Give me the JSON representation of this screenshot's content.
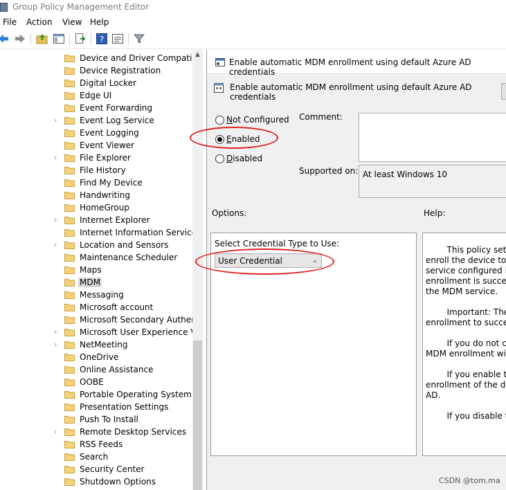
{
  "window": {
    "title": "Group Policy Management Editor"
  },
  "menu": {
    "items": [
      "File",
      "Action",
      "View",
      "Help"
    ]
  },
  "toolbar": {
    "buttons": [
      "back-icon",
      "forward-icon",
      "up-folder-icon",
      "show-hide-tree-icon",
      "export-list-icon",
      "help-icon",
      "properties-icon",
      "filter-icon"
    ]
  },
  "tree": {
    "items": [
      {
        "label": "Device and Driver Compatibilit",
        "expandable": false
      },
      {
        "label": "Device Registration",
        "expandable": false
      },
      {
        "label": "Digital Locker",
        "expandable": false
      },
      {
        "label": "Edge UI",
        "expandable": false
      },
      {
        "label": "Event Forwarding",
        "expandable": false
      },
      {
        "label": "Event Log Service",
        "expandable": true
      },
      {
        "label": "Event Logging",
        "expandable": false
      },
      {
        "label": "Event Viewer",
        "expandable": false
      },
      {
        "label": "File Explorer",
        "expandable": true
      },
      {
        "label": "File History",
        "expandable": false
      },
      {
        "label": "Find My Device",
        "expandable": false
      },
      {
        "label": "Handwriting",
        "expandable": false
      },
      {
        "label": "HomeGroup",
        "expandable": false
      },
      {
        "label": "Internet Explorer",
        "expandable": true
      },
      {
        "label": "Internet Information Services",
        "expandable": false
      },
      {
        "label": "Location and Sensors",
        "expandable": true
      },
      {
        "label": "Maintenance Scheduler",
        "expandable": false
      },
      {
        "label": "Maps",
        "expandable": false
      },
      {
        "label": "MDM",
        "expandable": false,
        "selected": true
      },
      {
        "label": "Messaging",
        "expandable": false
      },
      {
        "label": "Microsoft account",
        "expandable": false
      },
      {
        "label": "Microsoft Secondary Authentic",
        "expandable": false
      },
      {
        "label": "Microsoft User Experience Virtu",
        "expandable": true
      },
      {
        "label": "NetMeeting",
        "expandable": true
      },
      {
        "label": "OneDrive",
        "expandable": false
      },
      {
        "label": "Online Assistance",
        "expandable": false
      },
      {
        "label": "OOBE",
        "expandable": false
      },
      {
        "label": "Portable Operating System",
        "expandable": false
      },
      {
        "label": "Presentation Settings",
        "expandable": false
      },
      {
        "label": "Push To Install",
        "expandable": false
      },
      {
        "label": "Remote Desktop Services",
        "expandable": true
      },
      {
        "label": "RSS Feeds",
        "expandable": false
      },
      {
        "label": "Search",
        "expandable": false
      },
      {
        "label": "Security Center",
        "expandable": false
      },
      {
        "label": "Shutdown Options",
        "expandable": false
      }
    ]
  },
  "dialog": {
    "title": "Enable automatic MDM enrollment using default Azure AD credentials",
    "setting_name": "Enable automatic MDM enrollment using default Azure AD credentials",
    "state": {
      "options": [
        {
          "pre": "",
          "ul": "N",
          "post": "ot Configured"
        },
        {
          "pre": "",
          "ul": "E",
          "post": "nabled"
        },
        {
          "pre": "",
          "ul": "D",
          "post": "isabled"
        }
      ],
      "selected": "Enabled"
    },
    "comment_label": "Comment:",
    "comment_value": "",
    "supported_label": "Supported on:",
    "supported_value": "At least Windows 10",
    "options_label": "Options:",
    "help_label": "Help:",
    "options": {
      "credential_label": "Select Credential Type to Use:",
      "credential_value": "User Credential"
    },
    "help_lines": [
      "        This policy setti",
      "enroll the device to the",
      "service configured in A",
      "enrollment is successf",
      "the MDM service.",
      "",
      "        Important: The",
      "enrollment to succeed",
      "",
      "        If you do not co",
      "MDM enrollment will n",
      "",
      "        If you enable th",
      "enrollment of the devi",
      "AD.",
      "",
      "        If you disable th"
    ]
  },
  "watermark": "CSDN @tom.ma",
  "colors": {
    "annotation": "#e02020",
    "dialog_bg": "#f0f0f0",
    "selection": "#d9d9d9"
  }
}
